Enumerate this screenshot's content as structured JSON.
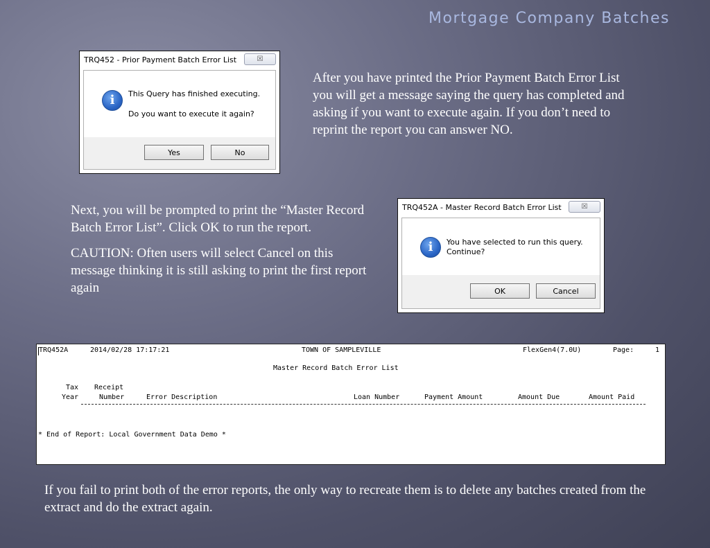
{
  "slide": {
    "title": "Mortgage Company Batches",
    "intro_text": "After you have printed the Prior Payment Batch Error List you will get a message saying the query has completed and asking if you want to execute again.  If you don’t need to reprint the report you can answer NO.",
    "prompt_text": "Next, you will be prompted to print the “Master Record Batch Error List”. Click OK to run the report.",
    "caution_text": "CAUTION: Often users will select Cancel on this message thinking it is still asking to print the first report again",
    "footer_text": "If you fail to print both of the error reports, the only way to recreate them is to delete any batches created from the extract and do the extract again."
  },
  "dialog1": {
    "title": "TRQ452 - Prior Payment Batch Error List",
    "close_symbol": "☒",
    "message_line1": "This Query has finished executing.",
    "message_line2": "Do you want to execute it again?",
    "yes_label": "Yes",
    "no_label": "No",
    "icon_glyph": "i"
  },
  "dialog2": {
    "title": "TRQ452A - Master Record Batch Error List",
    "close_symbol": "☒",
    "message_line1": "You have selected to run this query.",
    "message_line2": "Continue?",
    "ok_label": "OK",
    "cancel_label": "Cancel",
    "icon_glyph": "i"
  },
  "report": {
    "report_id": "TRQ452A",
    "datetime": "2014/02/28 17:17:21",
    "org": "TOWN OF SAMPLEVILLE",
    "version": "FlexGen4(7.0U)",
    "page_label": "Page:",
    "page_number": "1",
    "report_title": "Master Record Batch Error List",
    "headers": {
      "tax_top": "Tax",
      "tax_bottom": "Year",
      "receipt_top": "Receipt",
      "receipt_bottom": "Number",
      "error_description": "Error Description",
      "loan_number": "Loan Number",
      "payment_amount": "Payment Amount",
      "amount_due": "Amount Due",
      "amount_paid": "Amount Paid"
    },
    "end_line": "* End of Report: Local Government Data Demo *"
  }
}
